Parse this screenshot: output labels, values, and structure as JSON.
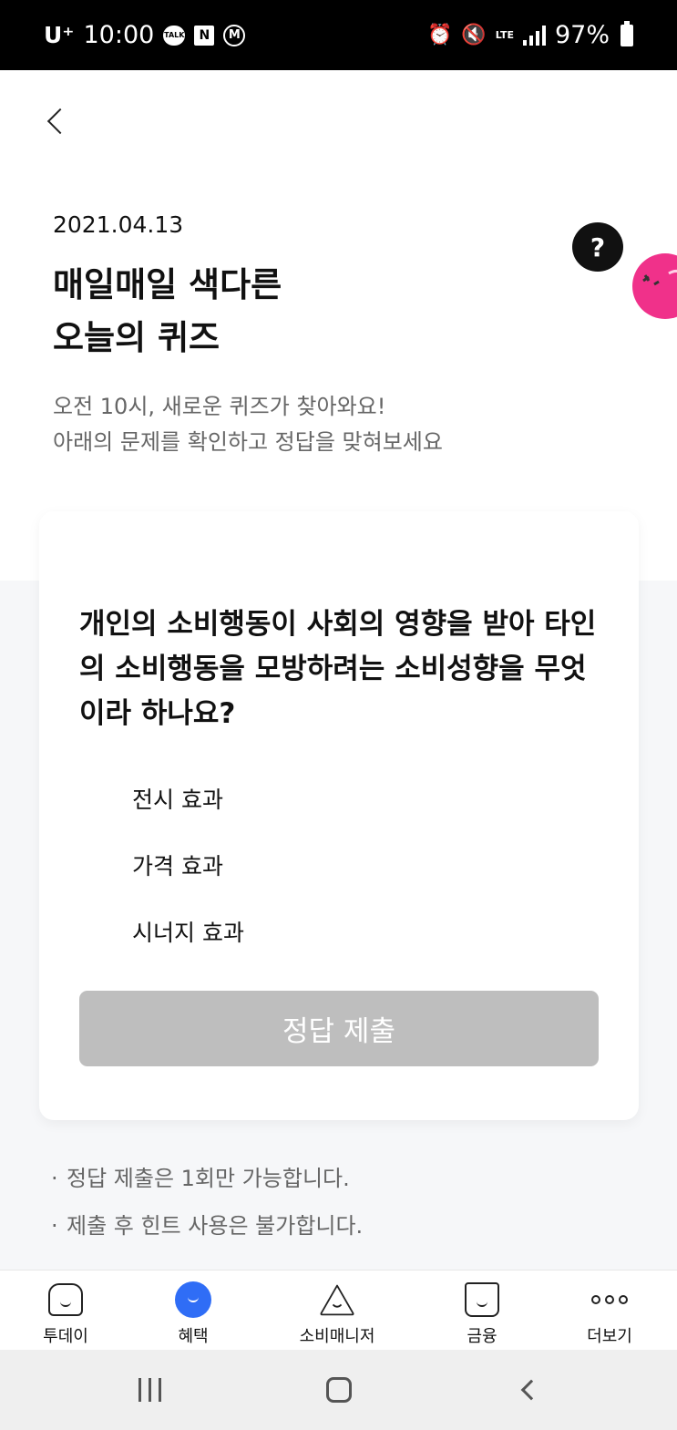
{
  "status_bar": {
    "carrier": "U⁺",
    "time": "10:00",
    "network": "LTE",
    "battery": "97%"
  },
  "header": {
    "date": "2021.04.13",
    "title_line1": "매일매일 색다른",
    "title_line2": "오늘의 퀴즈",
    "desc_line1": "오전 10시, 새로운 퀴즈가 찾아와요!",
    "desc_line2": "아래의 문제를 확인하고 정답을 맞혀보세요",
    "mascot_bubble": "?"
  },
  "quiz": {
    "question": "개인의 소비행동이 사회의 영향을 받아 타인의 소비행동을 모방하려는 소비성향을 무엇이라 하나요?",
    "options": [
      "전시 효과",
      "가격 효과",
      "시너지 효과"
    ],
    "submit_label": "정답 제출"
  },
  "notes": [
    "정답 제출은 1회만 가능합니다.",
    "제출 후 힌트 사용은 불가합니다."
  ],
  "bottom_nav": {
    "items": [
      {
        "label": "투데이",
        "icon": "house-icon"
      },
      {
        "label": "혜택",
        "icon": "benefit-icon",
        "active": true
      },
      {
        "label": "소비매니저",
        "icon": "triangle-icon"
      },
      {
        "label": "금융",
        "icon": "finance-icon"
      },
      {
        "label": "더보기",
        "icon": "more-icon"
      }
    ]
  },
  "colors": {
    "accent": "#2f6df6",
    "mascot_pink": "#f0318a",
    "submit_disabled": "#bebebe"
  }
}
